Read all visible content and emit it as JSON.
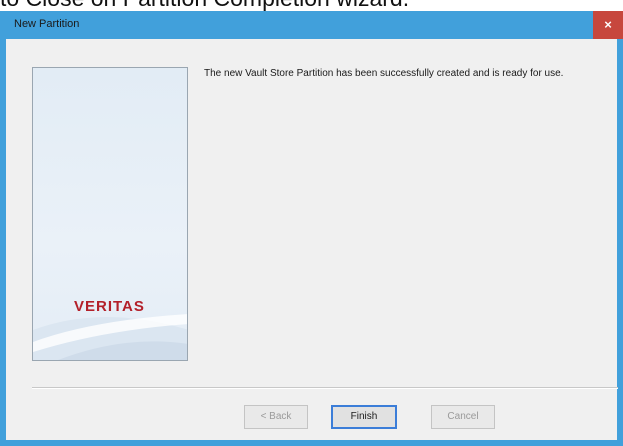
{
  "caption": "to Close on Partition Completion wizard.",
  "window": {
    "title": "New Partition",
    "close_label": "×"
  },
  "side_panel": {
    "logo_text": "VERITAS"
  },
  "message": "The new Vault Store Partition has been successfully created and is ready for use.",
  "buttons": {
    "back": "< Back",
    "finish": "Finish",
    "cancel": "Cancel"
  },
  "colors": {
    "title_bar": "#41a0db",
    "close_button": "#c7473d",
    "logo": "#b3202a",
    "default_button_border": "#3b7dd8"
  }
}
